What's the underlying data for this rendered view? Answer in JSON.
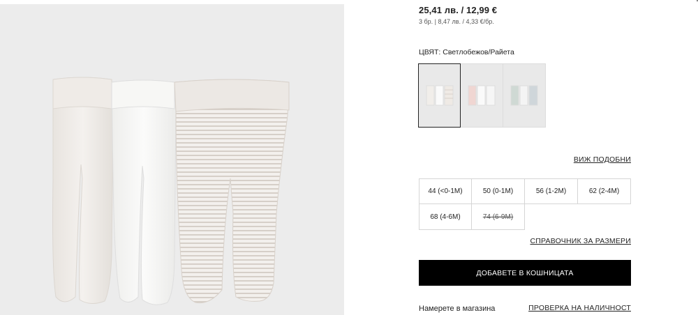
{
  "product": {
    "price": "25,41 лв. / 12,99 €",
    "unit_price": "3 бр. | 8,47 лв. / 4,33 €/бр.",
    "image_name": "baby-footed-leggings-3-pack"
  },
  "color": {
    "label": "ЦВЯТ: Светлобежов/Райета",
    "swatches": [
      {
        "name": "light-beige-striped",
        "selected": true
      },
      {
        "name": "pink-white",
        "selected": false
      },
      {
        "name": "grey-green",
        "selected": false
      }
    ]
  },
  "links": {
    "similar": "ВИЖ ПОДОБНИ",
    "size_guide": "СПРАВОЧНИК ЗА РАЗМЕРИ",
    "check_availability": "ПРОВЕРКА НА НАЛИЧНОСТ"
  },
  "sizes": [
    {
      "label": "44 (<0-1M)",
      "available": true
    },
    {
      "label": "50 (0-1M)",
      "available": true
    },
    {
      "label": "56 (1-2M)",
      "available": true
    },
    {
      "label": "62 (2-4M)",
      "available": true
    },
    {
      "label": "68 (4-6M)",
      "available": true
    },
    {
      "label": "74 (6-9M)",
      "available": false
    }
  ],
  "cart": {
    "add_label": "ДОБАВЕТЕ В КОШНИЦАТА"
  },
  "store": {
    "find_label": "Намерете в магазина"
  },
  "colors": {
    "image_bg": "#ececec",
    "button_bg": "#000000",
    "border": "#d5d5d5"
  }
}
